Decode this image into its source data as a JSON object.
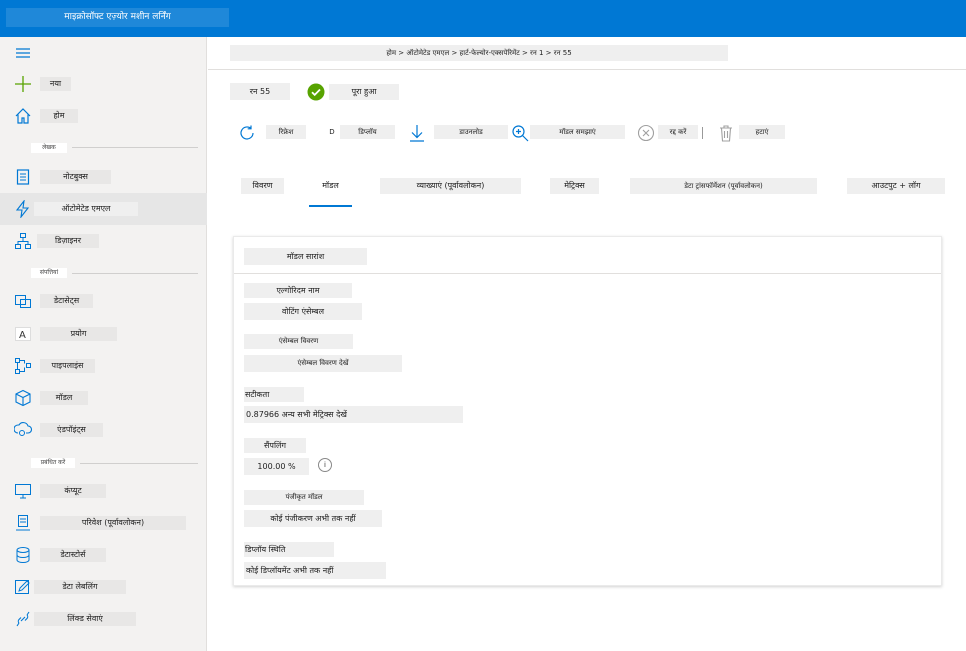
{
  "app": {
    "title": "माइक्रोसॉफ्ट एज़्योर मशीन लर्निंग"
  },
  "sidebar": {
    "items": [
      {
        "label": "नया",
        "icon": "plus-icon"
      },
      {
        "label": "होम",
        "icon": "home-icon"
      },
      {
        "label": "नोटबुक्स",
        "icon": "notebook-icon"
      },
      {
        "label": "ऑटोमेटेड एमएल",
        "icon": "lightning-icon"
      },
      {
        "label": "डिज़ाइनर",
        "icon": "designer-icon"
      },
      {
        "label": "डेटासेट्स",
        "icon": "datasets-icon"
      },
      {
        "label": "प्रयोग",
        "icon": "experiments-icon"
      },
      {
        "label": "पाइपलाइंस",
        "icon": "pipelines-icon"
      },
      {
        "label": "मॉडल",
        "icon": "models-icon"
      },
      {
        "label": "एंडपॉइंट्स",
        "icon": "endpoints-icon"
      },
      {
        "label": "कंप्यूट",
        "icon": "compute-icon"
      },
      {
        "label": "परिवेश (पूर्वावलोकन)",
        "icon": "environments-icon"
      },
      {
        "label": "डेटास्टोर्स",
        "icon": "datastores-icon"
      },
      {
        "label": "डेटा लेबलिंग",
        "icon": "data-labeling-icon"
      },
      {
        "label": "लिंक्ड सेवाएं",
        "icon": "linked-services-icon"
      }
    ],
    "sections": {
      "author": "लेखक",
      "assets": "संपत्तियां",
      "manage": "प्रबंधित करें"
    }
  },
  "breadcrumb": "होम > ऑटोमेटेड एमएल > हार्ट-फेल्योर-एक्सपेरिमेंट > रन 1 > रन 55",
  "run": {
    "name": "रन 55",
    "status": "पूरा हुआ",
    "status_color": "#57a300"
  },
  "toolbar": {
    "refresh": "रिफ्रेश",
    "deploy_prefix": "D",
    "deploy": "डिप्लॉय",
    "download": "डाउनलोड",
    "explain": "मॉडल समझाएं",
    "cancel": "रद्द करें",
    "delete": "हटाएं"
  },
  "tabs": [
    {
      "label": "विवरण"
    },
    {
      "label": "मॉडल",
      "active": true
    },
    {
      "label": "व्याख्याएं (पूर्वावलोकन)"
    },
    {
      "label": "मेट्रिक्स"
    },
    {
      "label": "डेटा ट्रांसफॉर्मेशन (पूर्वावलोकन)"
    },
    {
      "label": "आउटपुट + लॉग"
    }
  ],
  "model_summary": {
    "title": "मॉडल सारांश",
    "algorithm_label": "एल्गोरिदम नाम",
    "algorithm_value": "वोटिंग एंसेम्बल",
    "ensemble_label": "एंसेम्बल विवरण",
    "ensemble_value": "एंसेम्बल विवरण देखें",
    "accuracy_label": "सटीकता",
    "accuracy_value": "0.87966 अन्य सभी मेट्रिक्स देखें",
    "sampling_label": "सैंपलिंग",
    "sampling_value": "100.00 %",
    "sampling_info": "i",
    "registered_label": "पंजीकृत मॉडल",
    "registered_value": "कोई पंजीकरण अभी तक नहीं",
    "deploy_status_label": "डिप्लॉय स्थिति",
    "deploy_status_value": "कोई डिप्लॉयमेंट अभी तक नहीं"
  },
  "colors": {
    "accent": "#0078d4",
    "success": "#57a300"
  }
}
